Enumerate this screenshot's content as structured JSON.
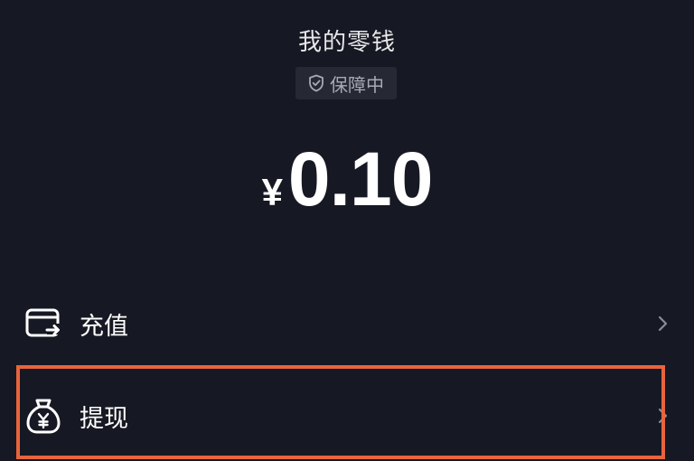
{
  "header": {
    "title": "我的零钱",
    "protect_badge": {
      "icon": "shield-check-icon",
      "label": "保障中"
    }
  },
  "balance": {
    "currency_symbol": "¥",
    "amount": "0.10"
  },
  "menu": [
    {
      "icon": "wallet-arrow-icon",
      "label": "充值",
      "chevron": "chevron-right-icon"
    },
    {
      "icon": "money-bag-yen-icon",
      "label": "提现",
      "chevron": "chevron-right-icon"
    }
  ],
  "colors": {
    "background": "#161823",
    "badge_background": "#262833",
    "highlight": "#e8643c",
    "text_primary": "#ffffff",
    "text_secondary": "#a8aab3"
  }
}
